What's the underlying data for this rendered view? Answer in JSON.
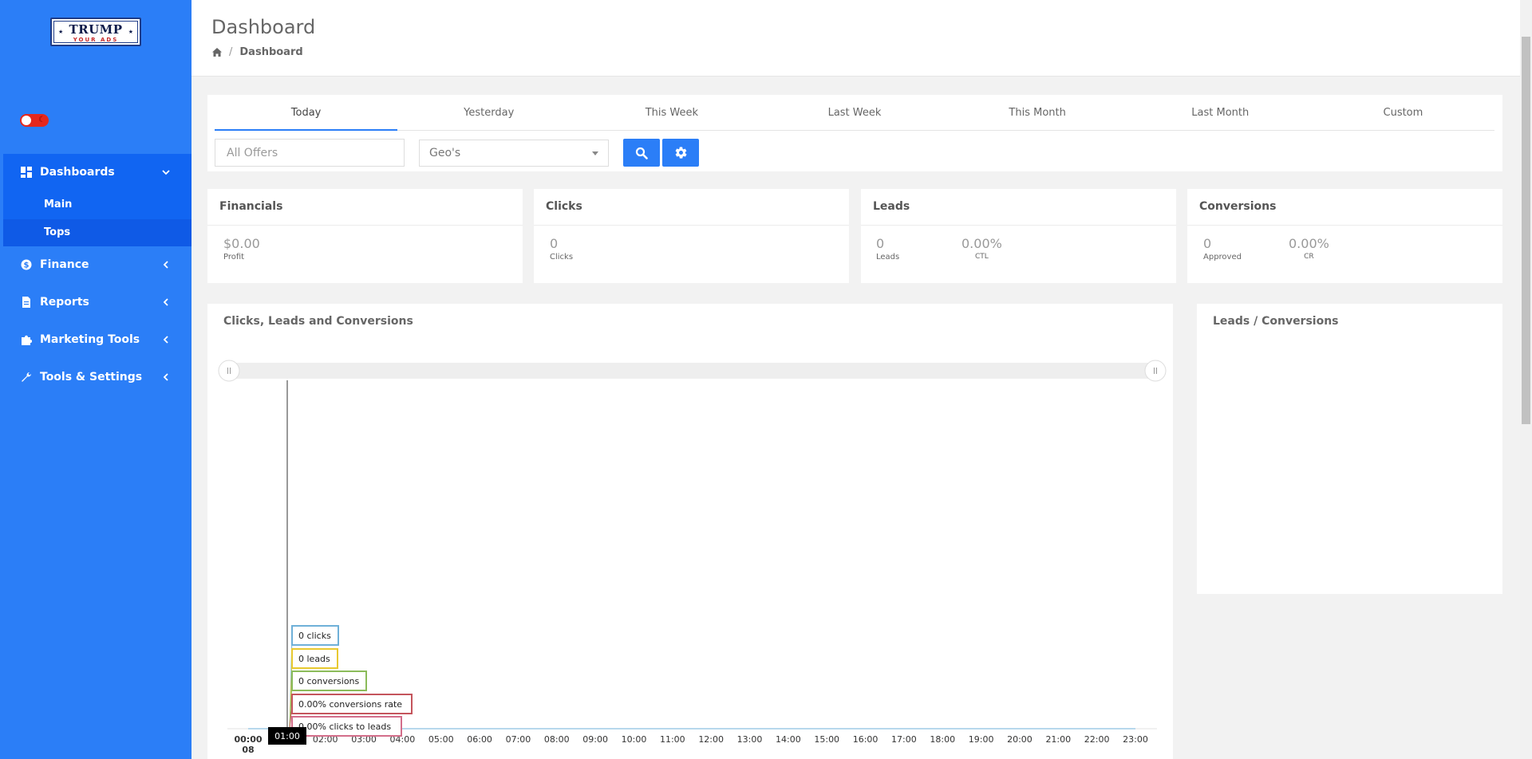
{
  "logo": {
    "line1": "TRUMP",
    "line2": "YOUR ADS"
  },
  "sidebar": {
    "items": [
      {
        "label": "Dashboards",
        "icon": "dashboard-icon"
      },
      {
        "label": "Finance",
        "icon": "dollar-icon"
      },
      {
        "label": "Reports",
        "icon": "document-icon"
      },
      {
        "label": "Marketing Tools",
        "icon": "puzzle-icon"
      },
      {
        "label": "Tools & Settings",
        "icon": "wrench-icon"
      }
    ],
    "sub_items": [
      {
        "label": "Main"
      },
      {
        "label": "Tops"
      }
    ]
  },
  "header": {
    "title": "Dashboard",
    "breadcrumb_current": "Dashboard"
  },
  "filters": {
    "tabs": [
      {
        "label": "Today"
      },
      {
        "label": "Yesterday"
      },
      {
        "label": "This Week"
      },
      {
        "label": "Last Week"
      },
      {
        "label": "This Month"
      },
      {
        "label": "Last Month"
      },
      {
        "label": "Custom"
      }
    ],
    "active_tab": "Today",
    "offers_placeholder": "All Offers",
    "geo_value": "Geo's"
  },
  "cards": {
    "financials": {
      "title": "Financials",
      "profit_value": "$0.00",
      "profit_label": "Profit"
    },
    "clicks": {
      "title": "Clicks",
      "clicks_value": "0",
      "clicks_label": "Clicks"
    },
    "leads": {
      "title": "Leads",
      "leads_value": "0",
      "leads_label": "Leads",
      "ctl_value": "0.00%",
      "ctl_label": "CTL"
    },
    "conversions": {
      "title": "Conversions",
      "approved_value": "0",
      "approved_label": "Approved",
      "cr_value": "0.00%",
      "cr_label": "CR"
    }
  },
  "chart": {
    "title": "Clicks, Leads and Conversions",
    "side_title": "Leads / Conversions"
  },
  "chart_data": {
    "type": "line",
    "x": [
      "00:00",
      "01:00",
      "02:00",
      "03:00",
      "04:00",
      "05:00",
      "06:00",
      "07:00",
      "08:00",
      "09:00",
      "10:00",
      "11:00",
      "12:00",
      "13:00",
      "14:00",
      "15:00",
      "16:00",
      "17:00",
      "18:00",
      "19:00",
      "20:00",
      "21:00",
      "22:00",
      "23:00"
    ],
    "x_first_sub": "08",
    "hover_label": "01:00",
    "tooltips": [
      {
        "text": "0 clicks",
        "color": "#6fb0d8"
      },
      {
        "text": "0 leads",
        "color": "#e8c931"
      },
      {
        "text": "0 conversions",
        "color": "#8bbb5a"
      },
      {
        "text": "0.00% conversions rate",
        "color": "#c4545c"
      },
      {
        "text": "0.00% clicks to leads",
        "color": "#d36e8a"
      }
    ],
    "series": [
      {
        "values": [
          0,
          0,
          0,
          0,
          0,
          0,
          0,
          0,
          0,
          0,
          0,
          0,
          0,
          0,
          0,
          0,
          0,
          0,
          0,
          0,
          0,
          0,
          0,
          0
        ]
      }
    ]
  },
  "colors": {
    "accent": "#2b7ef7",
    "sidebar_active": "#1165f2",
    "toggle": "#e5271c"
  }
}
